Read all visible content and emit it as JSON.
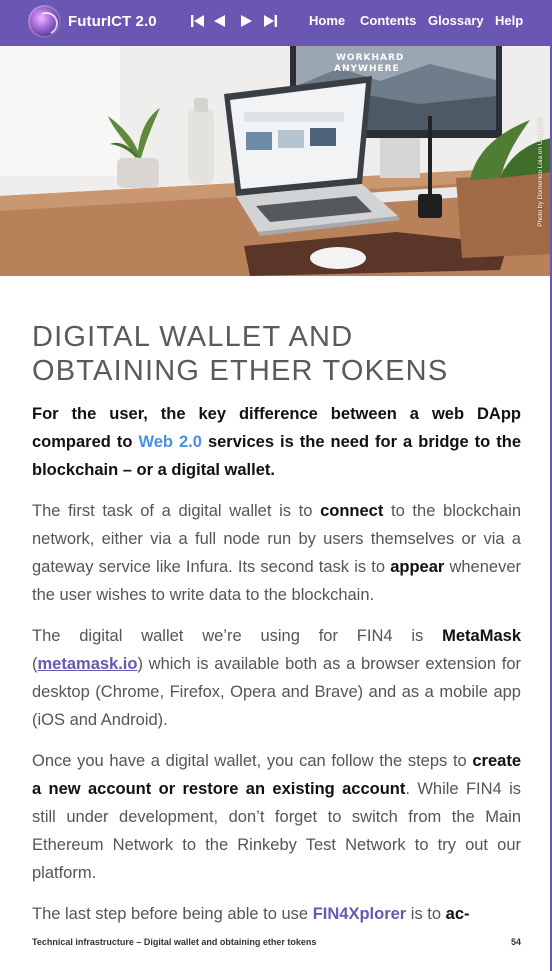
{
  "header": {
    "app_title": "FuturICT 2.0",
    "nav_controls": [
      {
        "icon": "first-page-icon"
      },
      {
        "icon": "previous-page-icon"
      },
      {
        "icon": "next-page-icon"
      },
      {
        "icon": "last-page-icon"
      }
    ],
    "menu": {
      "home": "Home",
      "contents": "Contents",
      "glossary": "Glossary",
      "help": "Help"
    },
    "bar_color": "#6a56b3"
  },
  "hero": {
    "monitor_text_line1": "WORKHARD",
    "monitor_text_line2": "ANYWHERE",
    "credit": "Photo by Domenico Loia on Unsplash"
  },
  "article": {
    "heading": "DIGITAL WALLET AND OBTAINING ETHER TOKENS",
    "intro": {
      "pre": "For the user, the key difference between a web DApp compared to ",
      "highlight": "Web 2.0",
      "post": " services is the need for a bridge to the blockchain – or a digital wallet."
    },
    "p1": {
      "t1": "The first task of a digital wallet is to ",
      "b1": "connect",
      "t2": " to the blockchain network, either via a full node run by users themselves or via a gateway service like Infura. Its second task is to ",
      "b2": "appear",
      "t3": " whenever the user wishes to write data to the blockchain."
    },
    "p2": {
      "t1": "The digital wallet we’re using for FIN4 is ",
      "b1": "MetaMask",
      "t2": " (",
      "link": "metamask.io",
      "t3": ") which is available both as a browser extension for desktop (Chrome, Firefox, Opera and Brave) and as a mobile app (iOS and Android)."
    },
    "p3": {
      "t1": "Once you have a digital wallet, you can follow the steps to ",
      "b1": "create a new account or restore an existing account",
      "t2": ". While FIN4 is still under development, don’t forget to switch from the Main Ethereum Network to the Rinkeby Test Network to try out our platform."
    },
    "p4": {
      "t1": "The last step before being able to use ",
      "hl": "FIN4Xplorer",
      "t2": " is to ",
      "b1": "ac-"
    }
  },
  "footer": {
    "section": "Technical  infrastructure – Digital wallet and  obtaining ether tokens",
    "page_number": "54"
  }
}
